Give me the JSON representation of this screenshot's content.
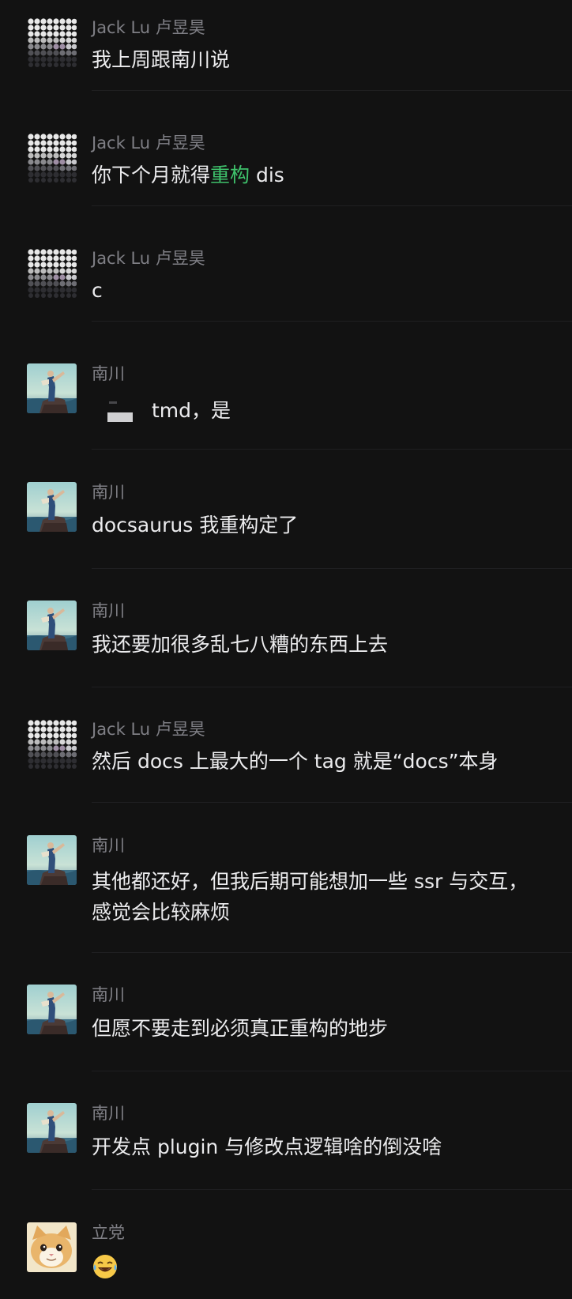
{
  "messages": [
    {
      "sender": "Jack Lu 卢昱昊",
      "avatar": "pixel-avatar-icon",
      "text": "我上周跟南川说"
    },
    {
      "sender": "Jack Lu 卢昱昊",
      "avatar": "pixel-avatar-icon",
      "text_before": "你下个月就得",
      "highlight": "重构",
      "text_after": " dis",
      "highlight_color": "#3ec16b"
    },
    {
      "sender": "Jack Lu 卢昱昊",
      "avatar": "pixel-avatar-icon",
      "text": "c"
    },
    {
      "sender": "南川",
      "avatar": "statue-avatar-icon",
      "text": "tmd，是",
      "sticker": "blurred-sticker"
    },
    {
      "sender": "南川",
      "avatar": "statue-avatar-icon",
      "text": "docsaurus 我重构定了"
    },
    {
      "sender": "南川",
      "avatar": "statue-avatar-icon",
      "text": "我还要加很多乱七八糟的东西上去"
    },
    {
      "sender": "Jack Lu 卢昱昊",
      "avatar": "pixel-avatar-icon",
      "text": "然后 docs 上最大的一个 tag 就是“docs”本身"
    },
    {
      "sender": "南川",
      "avatar": "statue-avatar-icon",
      "text": "其他都还好，但我后期可能想加一些 ssr 与交互，感觉会比较麻烦"
    },
    {
      "sender": "南川",
      "avatar": "statue-avatar-icon",
      "text": "但愿不要走到必须真正重构的地步"
    },
    {
      "sender": "南川",
      "avatar": "statue-avatar-icon",
      "text": "开发点 plugin 与修改点逻辑啥的倒没啥"
    },
    {
      "sender": "立党",
      "avatar": "cat-avatar-icon",
      "text": "😂",
      "emoji_name": "laughing-tears-emoji-icon"
    }
  ],
  "colors": {
    "background": "#121212",
    "sender": "#7f7f85",
    "text": "#ececee",
    "highlight": "#3ec16b"
  }
}
